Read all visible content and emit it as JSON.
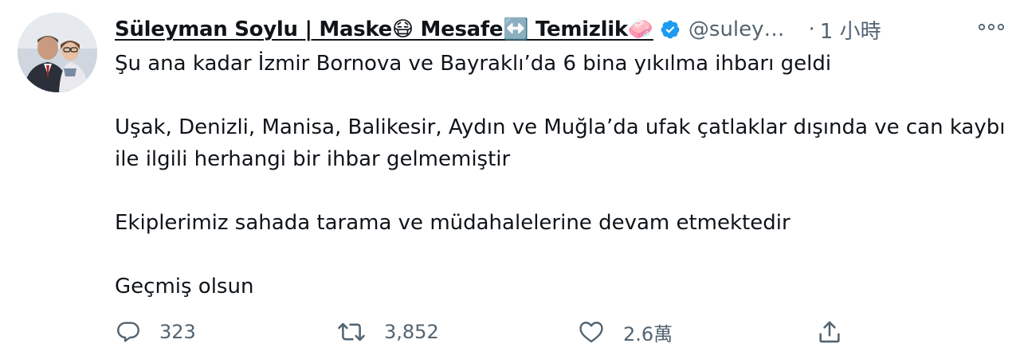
{
  "tweet": {
    "display_name": "Süleyman Soylu | Maske😷 Mesafe↔️ Temizlik🧼",
    "handle": "@suley…",
    "separator": "·",
    "time": "1 小時",
    "verified": true,
    "paragraphs": [
      "Şu ana kadar İzmir Bornova ve Bayraklı’da 6 bina yıkılma ihbarı geldi",
      "Uşak, Denizli, Manisa, Balikesir, Aydın ve Muğla’da ufak çatlaklar dışında ve can kaybı ile ilgili herhangi bir ihbar gelmemiştir",
      "Ekiplerimiz sahada tarama ve müdahalelerine devam etmektedir",
      "Geçmiş olsun"
    ],
    "actions": {
      "reply_count": "323",
      "retweet_count": "3,852",
      "like_count": "2.6萬"
    }
  },
  "icons": {
    "avatar": "profile-photo",
    "verified": "verified-badge-icon",
    "more": "more-dots-icon",
    "reply": "reply-bubble-icon",
    "retweet": "retweet-icon",
    "like": "heart-icon",
    "share": "share-upload-icon"
  },
  "colors": {
    "text": "#0f1419",
    "secondary": "#536471",
    "verified": "#1d9bf0"
  }
}
